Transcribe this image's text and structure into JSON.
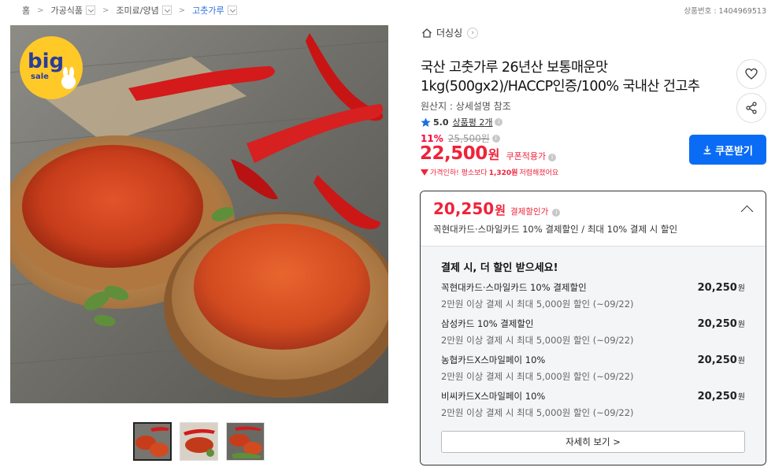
{
  "breadcrumb": [
    {
      "label": "홈",
      "dropdown": false
    },
    {
      "label": "가공식품",
      "dropdown": true
    },
    {
      "label": "조미료/양념",
      "dropdown": true
    },
    {
      "label": "고춧가루",
      "dropdown": true
    }
  ],
  "product_no": "상품번호 : 1404969513",
  "gallery": {
    "badge_big": "big",
    "badge_sale": "sale",
    "thumbnails": 3
  },
  "store": {
    "name": "더싱싱",
    "home_icon": "home-icon"
  },
  "product": {
    "title": "국산 고춧가루 26년산 보통매운맛 1kg(500gx2)/HACCP인증/100% 국내산 건고추",
    "origin": "원산지 : 상세설명 참조",
    "rating": "5.0",
    "review_label": "상품평 2개",
    "discount_rate": "11%",
    "original_price": "25,500원",
    "price": "22,500",
    "price_unit": "원",
    "coupon_price_label": "쿠폰적용가",
    "drop_note_prefix": "가격인하! 평소보다",
    "drop_note_amount": "1,320원",
    "drop_note_suffix": "저렴해졌어요"
  },
  "buttons": {
    "coupon": "쿠폰받기",
    "more": "자세히 보기 >"
  },
  "card_discount": {
    "best_price": "20,250",
    "best_price_unit": "원",
    "best_label": "결제할인가",
    "summary": "꼭현대카드·스마일카드 10% 결제할인 / 최대 10% 결제 시 할인",
    "section_title": "결제 시, 더 할인 받으세요!",
    "offers": [
      {
        "name": "꼭현대카드·스마일카드 10% 결제할인",
        "condition": "2만원 이상 결제 시 최대 5,000원 할인 (~09/22)",
        "price": "20,250",
        "unit": "원"
      },
      {
        "name": "삼성카드 10% 결제할인",
        "condition": "2만원 이상 결제 시 최대 5,000원 할인 (~09/22)",
        "price": "20,250",
        "unit": "원"
      },
      {
        "name": "농협카드X스마일페이 10%",
        "condition": "2만원 이상 결제 시 최대 5,000원 할인 (~09/22)",
        "price": "20,250",
        "unit": "원"
      },
      {
        "name": "비씨카드X스마일페이 10%",
        "condition": "2만원 이상 결제 시 최대 5,000원 할인 (~09/22)",
        "price": "20,250",
        "unit": "원"
      }
    ]
  },
  "colors": {
    "accent_red": "#f0223a",
    "accent_blue": "#0a6cf5",
    "star": "#1a6fe0"
  }
}
